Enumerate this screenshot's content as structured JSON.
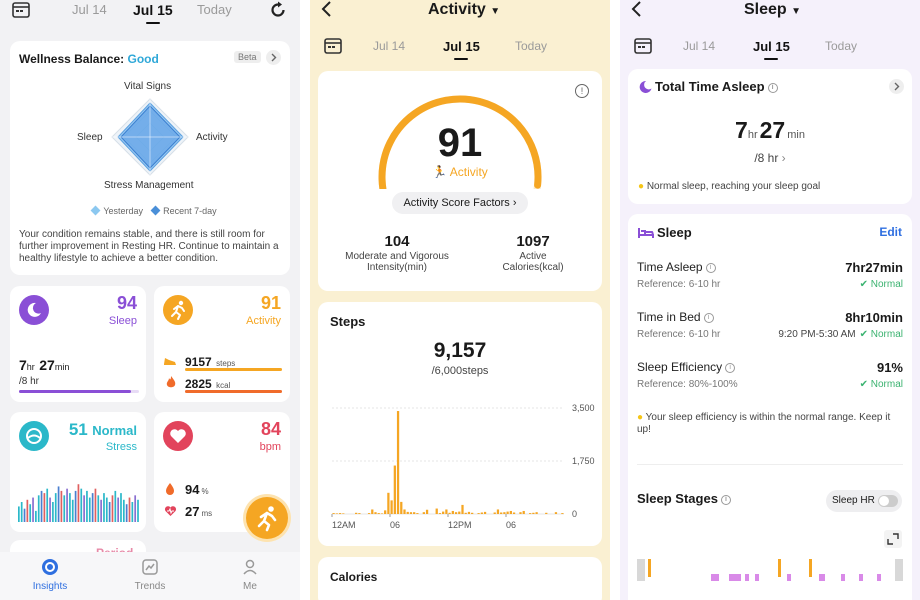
{
  "insights": {
    "dates": [
      "Jul 14",
      "Jul 15",
      "Today"
    ],
    "wellness": {
      "title": "Wellness Balance:",
      "status": "Good",
      "beta": "Beta",
      "axes": {
        "top": "Vital Signs",
        "left": "Sleep",
        "right": "Activity",
        "bottom": "Stress Management"
      },
      "legend": [
        "Yesterday",
        "Recent 7-day"
      ],
      "summary": "Your condition remains stable, and there is still room for further improvement in Resting HR. Continue to maintain a healthy lifestyle to achieve a better condition."
    },
    "sleep_card": {
      "score": "94",
      "label": "Sleep",
      "hours": "7",
      "hr_unit": "hr",
      "minutes": "27",
      "min_unit": "min",
      "goal": "/8 hr",
      "progress": 0.93
    },
    "activity_card": {
      "score": "91",
      "label": "Activity",
      "steps": "9157",
      "steps_unit": "steps",
      "kcal": "2825",
      "kcal_unit": "kcal",
      "steps_progress": 1.0,
      "kcal_progress": 1.0
    },
    "stress_card": {
      "value": "51",
      "status": "Normal",
      "label": "Stress",
      "bars": [
        14,
        18,
        12,
        20,
        16,
        22,
        10,
        24,
        28,
        26,
        30,
        22,
        18,
        26,
        32,
        28,
        24,
        30,
        26,
        20,
        28,
        34,
        30,
        24,
        28,
        22,
        26,
        30,
        24,
        20,
        26,
        22,
        18,
        24,
        28,
        22,
        26,
        20,
        16,
        22,
        18,
        24,
        20
      ]
    },
    "heart_card": {
      "value": "84",
      "unit": "bpm",
      "spo2": "94",
      "spo2_unit": "%",
      "hrv": "27",
      "hrv_unit": "ms"
    },
    "partial_card": "Period",
    "nav": [
      "Insights",
      "Trends",
      "Me"
    ],
    "colors": {
      "sleep": "#8a4fd6",
      "activity": "#f5a623",
      "stress": "#2bb8c9",
      "heart": "#e2445c",
      "good": "#2fa8d8"
    }
  },
  "activity": {
    "title": "Activity",
    "dates": [
      "Jul 14",
      "Jul 15",
      "Today"
    ],
    "score": "91",
    "score_label": "Activity",
    "score_fraction": 0.91,
    "factors_button": "Activity Score Factors",
    "stats": [
      {
        "value": "104",
        "label": "Moderate and Vigorous Intensity(min)"
      },
      {
        "value": "1097",
        "label": "Active Calories(kcal)"
      }
    ],
    "steps_section": "Steps",
    "steps_total": "9,157",
    "steps_goal": "/6,000steps",
    "calories_section": "Calories"
  },
  "chart_data": {
    "type": "bar",
    "title": "Steps",
    "x_tick_labels": [
      "12AM",
      "06",
      "12PM",
      "06"
    ],
    "y_tick_labels": [
      "3,500",
      "1,750",
      "0"
    ],
    "ylim": [
      0,
      3500
    ],
    "grid": true,
    "values": [
      30,
      20,
      30,
      20,
      0,
      0,
      0,
      40,
      30,
      0,
      0,
      30,
      150,
      60,
      30,
      20,
      120,
      700,
      450,
      1600,
      3400,
      400,
      150,
      70,
      60,
      60,
      30,
      0,
      60,
      140,
      0,
      0,
      180,
      30,
      80,
      150,
      40,
      100,
      60,
      80,
      300,
      40,
      70,
      40,
      0,
      30,
      50,
      70,
      0,
      0,
      50,
      150,
      50,
      60,
      80,
      100,
      50,
      0,
      60,
      100,
      0,
      30,
      40,
      60,
      0,
      0,
      40,
      0,
      0,
      60,
      0,
      30
    ]
  },
  "sleep": {
    "title": "Sleep",
    "dates": [
      "Jul 14",
      "Jul 15",
      "Today"
    ],
    "total_title": "Total Time Asleep",
    "hours": "7",
    "hr_unit": "hr",
    "minutes": "27",
    "min_unit": "min",
    "goal": "/8 hr",
    "tip": "Normal sleep, reaching your sleep goal",
    "section": "Sleep",
    "edit": "Edit",
    "rows": [
      {
        "label": "Time Asleep",
        "ref": "Reference: 6-10 hr",
        "value": "7hr27min",
        "status": "Normal",
        "extra": ""
      },
      {
        "label": "Time in Bed",
        "ref": "Reference: 6-10 hr",
        "value": "8hr10min",
        "status": "Normal",
        "extra": "9:20 PM-5:30 AM"
      },
      {
        "label": "Sleep Efficiency",
        "ref": "Reference: 80%-100%",
        "value": "91%",
        "status": "Normal",
        "extra": ""
      }
    ],
    "efficiency_tip": "Your sleep efficiency is within the normal range. Keep it up!",
    "stages_title": "Sleep Stages",
    "sleep_hr": "Sleep HR"
  }
}
